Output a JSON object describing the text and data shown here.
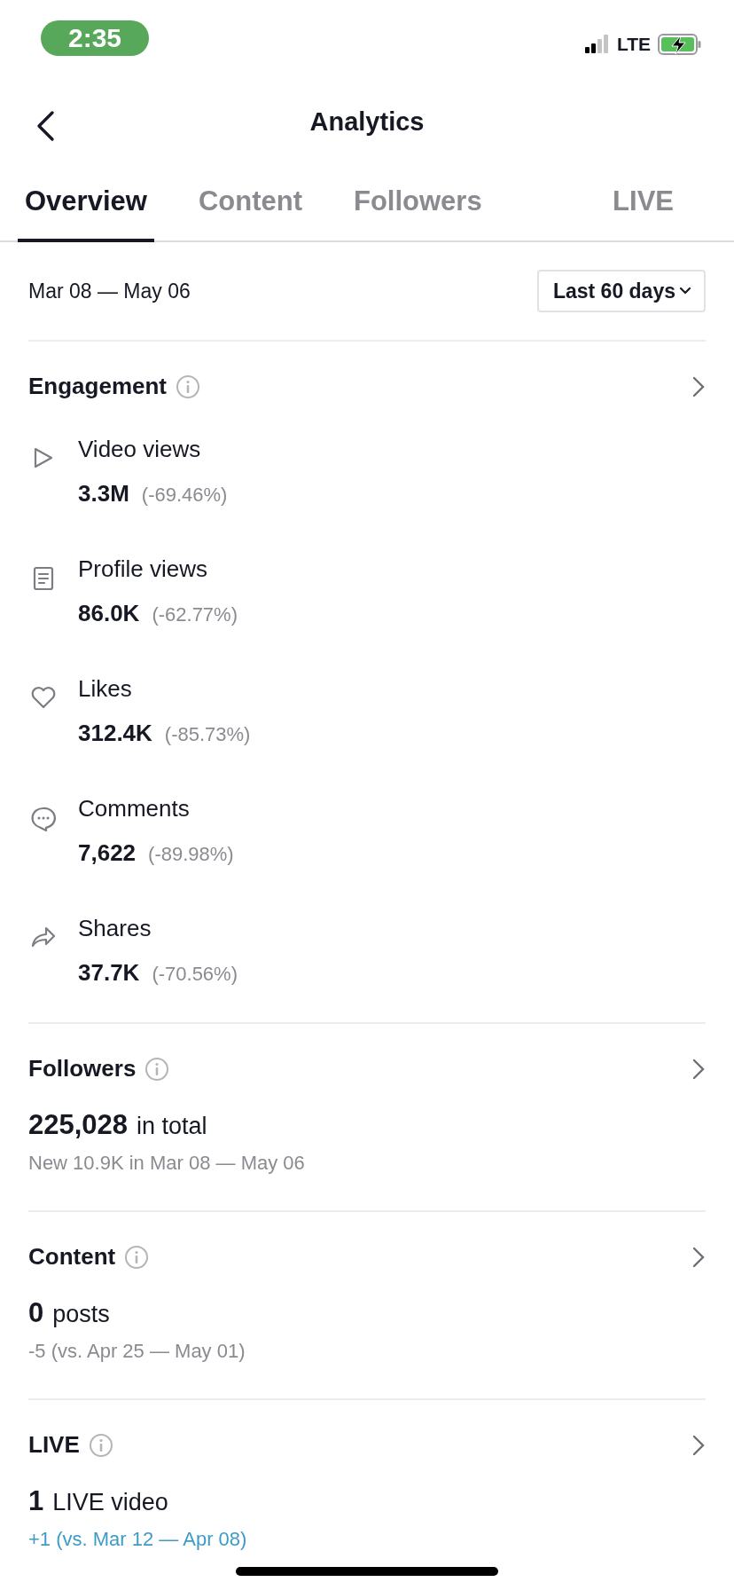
{
  "status_bar": {
    "time": "2:35",
    "network": "LTE"
  },
  "header": {
    "title": "Analytics"
  },
  "tabs": [
    {
      "label": "Overview",
      "selected": true
    },
    {
      "label": "Content",
      "selected": false
    },
    {
      "label": "Followers",
      "selected": false
    },
    {
      "label": "LIVE",
      "selected": false
    }
  ],
  "date_range": {
    "text": "Mar 08 — May 06",
    "dropdown": "Last 60 days"
  },
  "engagement": {
    "title": "Engagement",
    "metrics": [
      {
        "kind": "play",
        "label": "Video views",
        "value": "3.3M",
        "change": "(-69.46%)"
      },
      {
        "kind": "document",
        "label": "Profile views",
        "value": "86.0K",
        "change": "(-62.77%)"
      },
      {
        "kind": "heart",
        "label": "Likes",
        "value": "312.4K",
        "change": "(-85.73%)"
      },
      {
        "kind": "comment",
        "label": "Comments",
        "value": "7,622",
        "change": "(-89.98%)"
      },
      {
        "kind": "share",
        "label": "Shares",
        "value": "37.7K",
        "change": "(-70.56%)"
      }
    ]
  },
  "sections": [
    {
      "title": "Followers",
      "value": "225,028",
      "suffix": "in total",
      "note": "New 10.9K in Mar 08 — May 06",
      "color": "#8a8b91"
    },
    {
      "title": "Content",
      "value": "0",
      "suffix": "posts",
      "note": "-5 (vs. Apr 25 — May 01)",
      "color": "#8a8b91"
    },
    {
      "title": "LIVE",
      "value": "1",
      "suffix": "LIVE video",
      "note": "+1 (vs. Mar 12 — Apr 08)",
      "color": "#3e9bc6"
    }
  ]
}
